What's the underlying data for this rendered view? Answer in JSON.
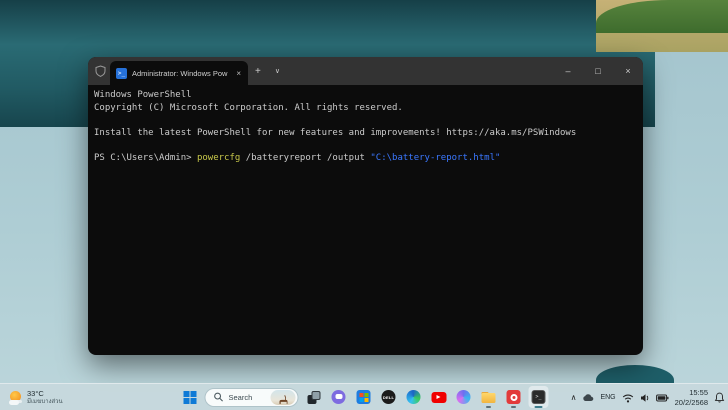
{
  "colors": {
    "accent_blue": "#0078D4",
    "terminal_bg": "#0C0C0C",
    "titlebar_bg": "#333333",
    "command_yellow": "#C9C94B",
    "string_blue": "#3B78FF",
    "taskbar_bg": "#C7D8DD"
  },
  "window": {
    "tab_title": "Administrator: Windows Pow",
    "ps_icon_glyph": ">_",
    "tab_close_glyph": "×",
    "new_tab_glyph": "+",
    "tab_dropdown_glyph": "∨",
    "controls": {
      "minimize": "–",
      "maximize": "□",
      "close": "×"
    }
  },
  "terminal": {
    "banner_line1": "Windows PowerShell",
    "banner_line2": "Copyright (C) Microsoft Corporation. All rights reserved.",
    "update_line": "Install the latest PowerShell for new features and improvements! https://aka.ms/PSWindows",
    "prompt": "PS C:\\Users\\Admin> ",
    "command": "powercfg",
    "arguments": " /batteryreport /output ",
    "string_arg": "\"C:\\battery-report.html\""
  },
  "taskbar": {
    "weather": {
      "temp": "33°C",
      "condition": "มีเมฆบางส่วน"
    },
    "search": {
      "label": "Search"
    },
    "apps": {
      "dell_label": "DELL",
      "terminal_glyph": ">_"
    },
    "tray": {
      "hidden_icons_glyph": "∧",
      "language": "ENG",
      "time": "15:55",
      "date": "20/2/2568"
    }
  }
}
